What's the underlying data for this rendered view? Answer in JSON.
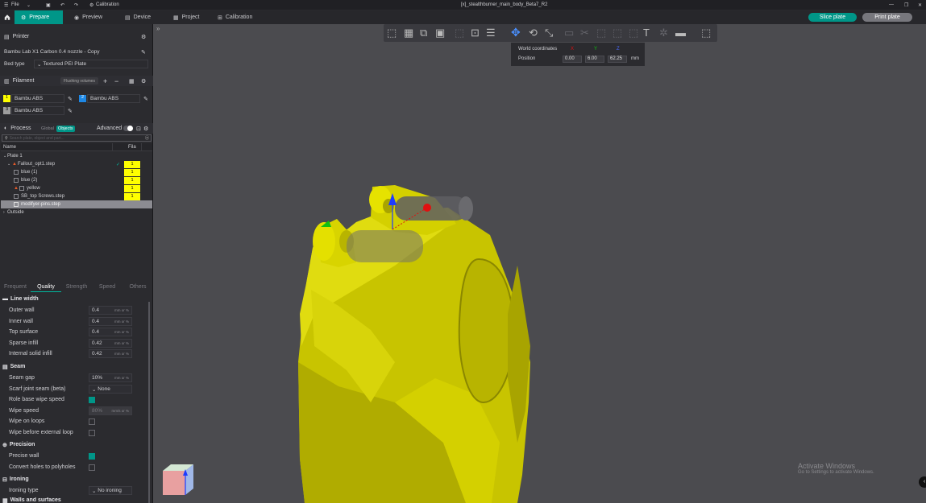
{
  "titlebar": {
    "menu": "File",
    "calibration": "Calibration",
    "doc_title": "[x]_stealthburner_main_body_Beta7_R2"
  },
  "nav": {
    "prepare": "Prepare",
    "preview": "Preview",
    "device": "Device",
    "project": "Project",
    "calibration": "Calibration",
    "slice": "Slice plate",
    "print": "Print plate"
  },
  "printer": {
    "header": "Printer",
    "model": "Bambu Lab X1 Carbon 0.4 nozzle - Copy",
    "bed_label": "Bed type",
    "bed_value": "Textured PEI Plate"
  },
  "filament": {
    "header": "Filament",
    "flushing": "Flushing volumes",
    "slots": [
      {
        "num": "1",
        "name": "Bambu ABS",
        "color": "#ffff00"
      },
      {
        "num": "2",
        "name": "Bambu ABS",
        "color": "#1e88e5"
      },
      {
        "num": "3",
        "name": "Bambu ABS",
        "color": "#9e9e9e"
      }
    ]
  },
  "process": {
    "header": "Process",
    "global": "Global",
    "objects": "Objects",
    "advanced": "Advanced",
    "search_placeholder": "Search plate, object and part..."
  },
  "objects": {
    "col_name": "Name",
    "col_fila": "Fila",
    "plate": "Plate 1",
    "rows": [
      {
        "name": "Fallout_opt1.step",
        "fila": "1"
      },
      {
        "name": "blue (1)",
        "fila": "1"
      },
      {
        "name": "blue (2)",
        "fila": "1"
      },
      {
        "name": "yellow",
        "fila": "1"
      },
      {
        "name": "SB_top Screws.step",
        "fila": "1"
      },
      {
        "name": "modifyer-pins.step",
        "fila": ""
      }
    ],
    "outside": "Outside"
  },
  "tabs": [
    "Frequent",
    "Quality",
    "Strength",
    "Speed",
    "Others"
  ],
  "line_width": {
    "header": "Line width",
    "rows": [
      {
        "label": "Outer wall",
        "value": "0.4",
        "unit": "mm or %"
      },
      {
        "label": "Inner wall",
        "value": "0.4",
        "unit": "mm or %"
      },
      {
        "label": "Top surface",
        "value": "0.4",
        "unit": "mm or %"
      },
      {
        "label": "Sparse infill",
        "value": "0.42",
        "unit": "mm or %"
      },
      {
        "label": "Internal solid infill",
        "value": "0.42",
        "unit": "mm or %"
      }
    ]
  },
  "seam": {
    "header": "Seam",
    "gap_label": "Seam gap",
    "gap_value": "10%",
    "gap_unit": "mm or %",
    "scarf_label": "Scarf joint seam (beta)",
    "scarf_value": "None",
    "role_label": "Role base wipe speed",
    "wipe_speed_label": "Wipe speed",
    "wipe_speed_value": "80%",
    "wipe_speed_unit": "mm/s or %",
    "wipe_loops_label": "Wipe on loops",
    "wipe_before_label": "Wipe before external loop"
  },
  "precision": {
    "header": "Precision",
    "precise_wall": "Precise wall",
    "convert_holes": "Convert holes to polyholes"
  },
  "ironing": {
    "header": "Ironing",
    "type_label": "Ironing type",
    "type_value": "No ironing",
    "next_header": "Walls and surfaces"
  },
  "coords": {
    "title": "World coordinates",
    "axis_x": "X",
    "axis_y": "Y",
    "axis_z": "Z",
    "position_label": "Position",
    "x": "0.00",
    "y": "6.00",
    "z": "62.25",
    "unit": "mm"
  },
  "activate": {
    "line1": "Activate Windows",
    "line2": "Go to Settings to activate Windows."
  }
}
